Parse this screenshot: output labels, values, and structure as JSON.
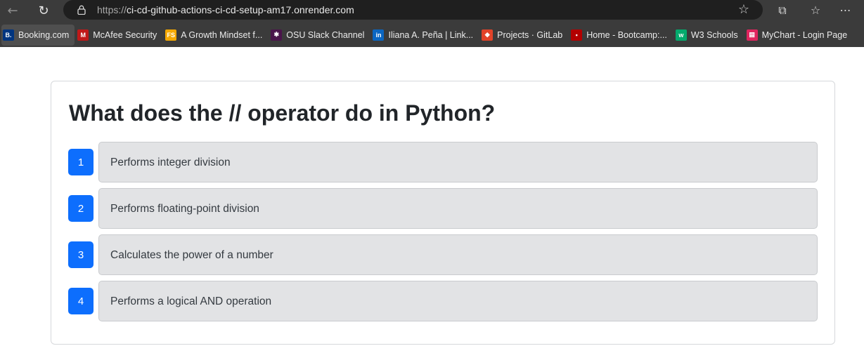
{
  "browser": {
    "url_scheme": "https://",
    "url_host": "ci-cd-github-actions-ci-cd-setup-am17.onrender.com",
    "icons": {
      "back": "back-arrow-icon",
      "reload": "reload-icon",
      "lock": "lock-icon",
      "star": "star-icon",
      "extensions": "extensions-icon",
      "favorites": "favorites-icon",
      "more": "more-icon"
    }
  },
  "bookmarks": [
    {
      "label": "Booking.com",
      "icon_text": "B.",
      "color": "#003580"
    },
    {
      "label": "McAfee Security",
      "icon_text": "M",
      "color": "#c01818"
    },
    {
      "label": "A Growth Mindset f...",
      "icon_text": "FS",
      "color": "#f5a800"
    },
    {
      "label": "OSU Slack Channel",
      "icon_text": "✱",
      "color": "#4a154b"
    },
    {
      "label": "Iliana A. Peña | Link...",
      "icon_text": "in",
      "color": "#0a66c2"
    },
    {
      "label": "Projects · GitLab",
      "icon_text": "◆",
      "color": "#e24329"
    },
    {
      "label": "Home - Bootcamp:...",
      "icon_text": "▪",
      "color": "#b30000"
    },
    {
      "label": "W3 Schools",
      "icon_text": "w",
      "color": "#04aa6d"
    },
    {
      "label": "MyChart - Login Page",
      "icon_text": "▤",
      "color": "#e0245e"
    }
  ],
  "quiz": {
    "question": "What does the // operator do in Python?",
    "options": [
      {
        "number": "1",
        "label": "Performs integer division"
      },
      {
        "number": "2",
        "label": "Performs floating-point division"
      },
      {
        "number": "3",
        "label": "Calculates the power of a number"
      },
      {
        "number": "4",
        "label": "Performs a logical AND operation"
      }
    ]
  },
  "colors": {
    "accent": "#0d6efd",
    "option_bg": "#e2e3e5",
    "chrome_bg": "#3b3b3b"
  }
}
